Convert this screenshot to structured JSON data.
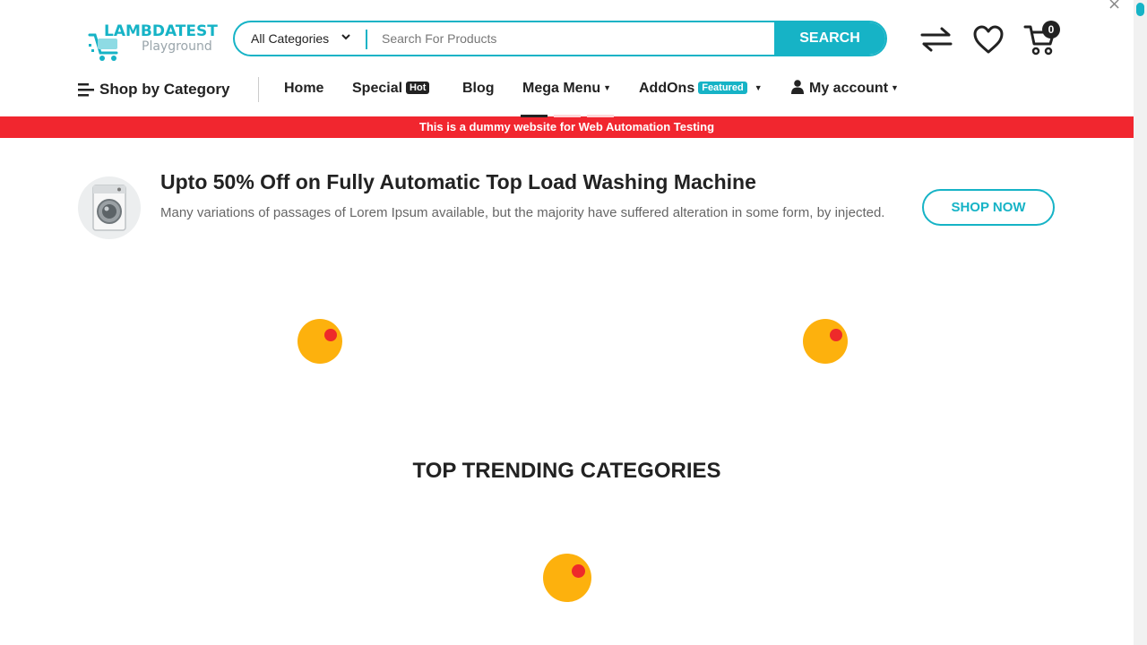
{
  "header": {
    "logo_title": "LAMBDATEST",
    "logo_subtitle": "Playground",
    "category_select": "All Categories",
    "search_placeholder": "Search For Products",
    "search_button": "SEARCH",
    "cart_count": "0"
  },
  "nav": {
    "shop_by_category": "Shop by Category",
    "home": "Home",
    "special": "Special",
    "special_badge": "Hot",
    "blog": "Blog",
    "mega_menu": "Mega Menu",
    "addons": "AddOns",
    "addons_badge": "Featured",
    "my_account": "My account"
  },
  "banner": {
    "text": "This is a dummy website for Web Automation Testing"
  },
  "promo": {
    "title": "Upto 50% Off on Fully Automatic Top Load Washing Machine",
    "description": "Many variations of passages of Lorem Ipsum available, but the majority have suffered alteration in some form, by injected.",
    "button": "SHOP NOW"
  },
  "sections": {
    "trending_title": "TOP TRENDING CATEGORIES"
  },
  "colors": {
    "accent": "#16b3c6",
    "banner": "#f1262f",
    "loader": "#fdb10d",
    "loader_dot": "#ee2a2a"
  },
  "icons": [
    "cart-logo-icon",
    "chevron-down-icon",
    "compare-icon",
    "heart-icon",
    "cart-icon",
    "hamburger-icon",
    "user-icon",
    "close-icon",
    "washing-machine-icon"
  ]
}
